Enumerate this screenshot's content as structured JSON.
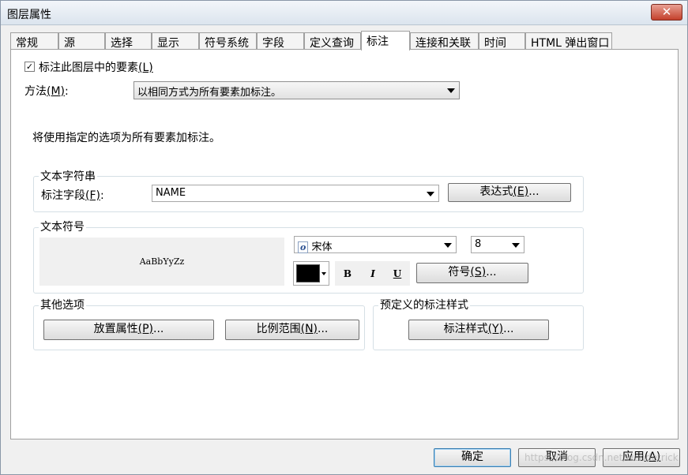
{
  "window": {
    "title": "图层属性",
    "close_label": "✕"
  },
  "tabs": [
    {
      "label": "常规"
    },
    {
      "label": "源"
    },
    {
      "label": "选择"
    },
    {
      "label": "显示"
    },
    {
      "label": "符号系统"
    },
    {
      "label": "字段"
    },
    {
      "label": "定义查询"
    },
    {
      "label": "标注"
    },
    {
      "label": "连接和关联"
    },
    {
      "label": "时间"
    },
    {
      "label": "HTML 弹出窗口"
    }
  ],
  "label_checkbox": {
    "checked_glyph": "✓",
    "label_text": "标注此图层中的要素",
    "accel": "(L)"
  },
  "method": {
    "label": "方法",
    "accel": "(M)",
    "suffix": ":",
    "value": "以相同方式为所有要素加标注。"
  },
  "info_text": "将使用指定的选项为所有要素加标注。",
  "text_string": {
    "title": "文本字符串",
    "field_label": "标注字段",
    "field_accel": "(F)",
    "field_suffix": ":",
    "field_value": "NAME",
    "expression_button": {
      "text": "表达式",
      "accel": "(E)",
      "suffix": "..."
    }
  },
  "text_symbol": {
    "title": "文本符号",
    "preview_text": "AaBbYyZz",
    "font_icon": "o",
    "font_name": "宋体",
    "font_size": "8",
    "color": "#000000",
    "bold": "B",
    "italic": "I",
    "underline": "U",
    "symbol_button": {
      "text": "符号",
      "accel": "(S)",
      "suffix": "..."
    }
  },
  "other_options": {
    "title": "其他选项",
    "placement_button": {
      "text": "放置属性",
      "accel": "(P)",
      "suffix": "..."
    },
    "scale_button": {
      "text": "比例范围",
      "accel": "(N)",
      "suffix": "..."
    }
  },
  "predefined_styles": {
    "title": "预定义的标注样式",
    "styles_button": {
      "text": "标注样式",
      "accel": "(Y)",
      "suffix": "..."
    }
  },
  "footer": {
    "ok": "确定",
    "cancel": "取消",
    "apply_text": "应用",
    "apply_accel": "(A)",
    "watermark": "https://blog.csdn.net/webdetrick"
  }
}
